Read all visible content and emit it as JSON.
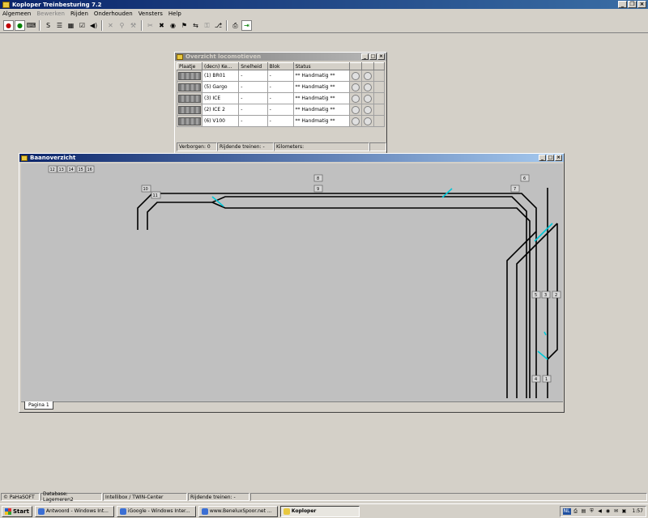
{
  "app": {
    "title": "Koploper Treinbesturing 7.2"
  },
  "menu": [
    "Algemeen",
    "Bewerken",
    "Rijden",
    "Onderhouden",
    "Vensters",
    "Help"
  ],
  "toolbar": {
    "icons": [
      "locomotive-red-icon",
      "locomotive-green-icon",
      "keyboard-icon",
      "switch-icon",
      "list-icon",
      "grid-icon",
      "check-icon",
      "speaker-icon",
      "arrows-icon",
      "lock-icon",
      "wrench-icon",
      "stop-icon",
      "speaker-off-icon",
      "train-icon",
      "undo-icon",
      "route-icon",
      "print-icon",
      "exit-icon"
    ]
  },
  "loco_window": {
    "title": "Overzicht locomotieven",
    "columns": [
      "Plaatje",
      "(decn) Ke...",
      "Snelheid",
      "Blok",
      "Status"
    ],
    "rows": [
      {
        "name": "(1) BR01",
        "speed": "-",
        "block": "-",
        "status": "** Handmatig **"
      },
      {
        "name": "(5) Gargo",
        "speed": "-",
        "block": "-",
        "status": "** Handmatig **"
      },
      {
        "name": "(3) ICE",
        "speed": "-",
        "block": "-",
        "status": "** Handmatig **"
      },
      {
        "name": "(2) ICE 2",
        "speed": "-",
        "block": "-",
        "status": "** Handmatig **"
      },
      {
        "name": "(6) V100",
        "speed": "-",
        "block": "-",
        "status": "** Handmatig **"
      }
    ],
    "status": {
      "hidden": "Verborgen: 0",
      "driving": "Rijdende treinen: -",
      "km": "Kilometers:"
    }
  },
  "baan_window": {
    "title": "Baanoverzicht",
    "page_tab": "Pagina 1",
    "blocks": [
      "12",
      "13",
      "14",
      "15",
      "16",
      "10",
      "11",
      "8",
      "9",
      "6",
      "7",
      "5",
      "3",
      "2",
      "4",
      "1"
    ]
  },
  "status_bar": [
    "© PaHaSOFT",
    "Database: Lagemeren2",
    "Intellibox / TWIN-Center",
    "Rijdende treinen: -"
  ],
  "taskbar": {
    "start": "Start",
    "tasks": [
      "Antwoord - Windows Int...",
      "iGoogle - Windows Inter...",
      "www.BeneluxSpoor.net ...",
      "Koploper"
    ],
    "tray_text": "NL",
    "clock": "1:57"
  }
}
